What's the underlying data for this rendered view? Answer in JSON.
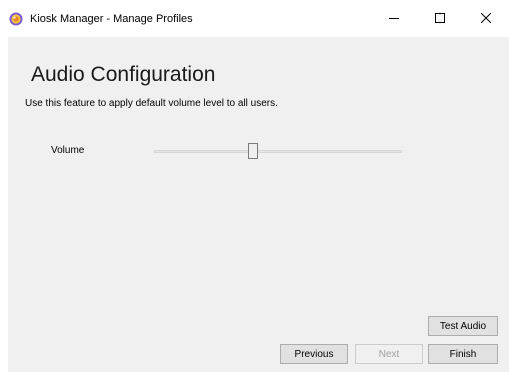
{
  "window": {
    "title": "Kiosk Manager - Manage Profiles",
    "icon": "kiosk-app-icon",
    "controls": {
      "minimize_icon": "minimize-icon",
      "maximize_icon": "maximize-icon",
      "close_icon": "close-icon"
    }
  },
  "page": {
    "title": "Audio Configuration",
    "subtitle": "Use this feature to apply default volume level to all users."
  },
  "volume": {
    "label": "Volume",
    "level": 0.4
  },
  "buttons": {
    "test_audio": "Test Audio",
    "previous": "Previous",
    "next": "Next",
    "next_enabled": false,
    "finish": "Finish"
  },
  "colors": {
    "content_background": "#f0f0f0",
    "button_background": "#e1e1e1",
    "button_border": "#adadad",
    "disabled_text": "#a0a0a0"
  }
}
